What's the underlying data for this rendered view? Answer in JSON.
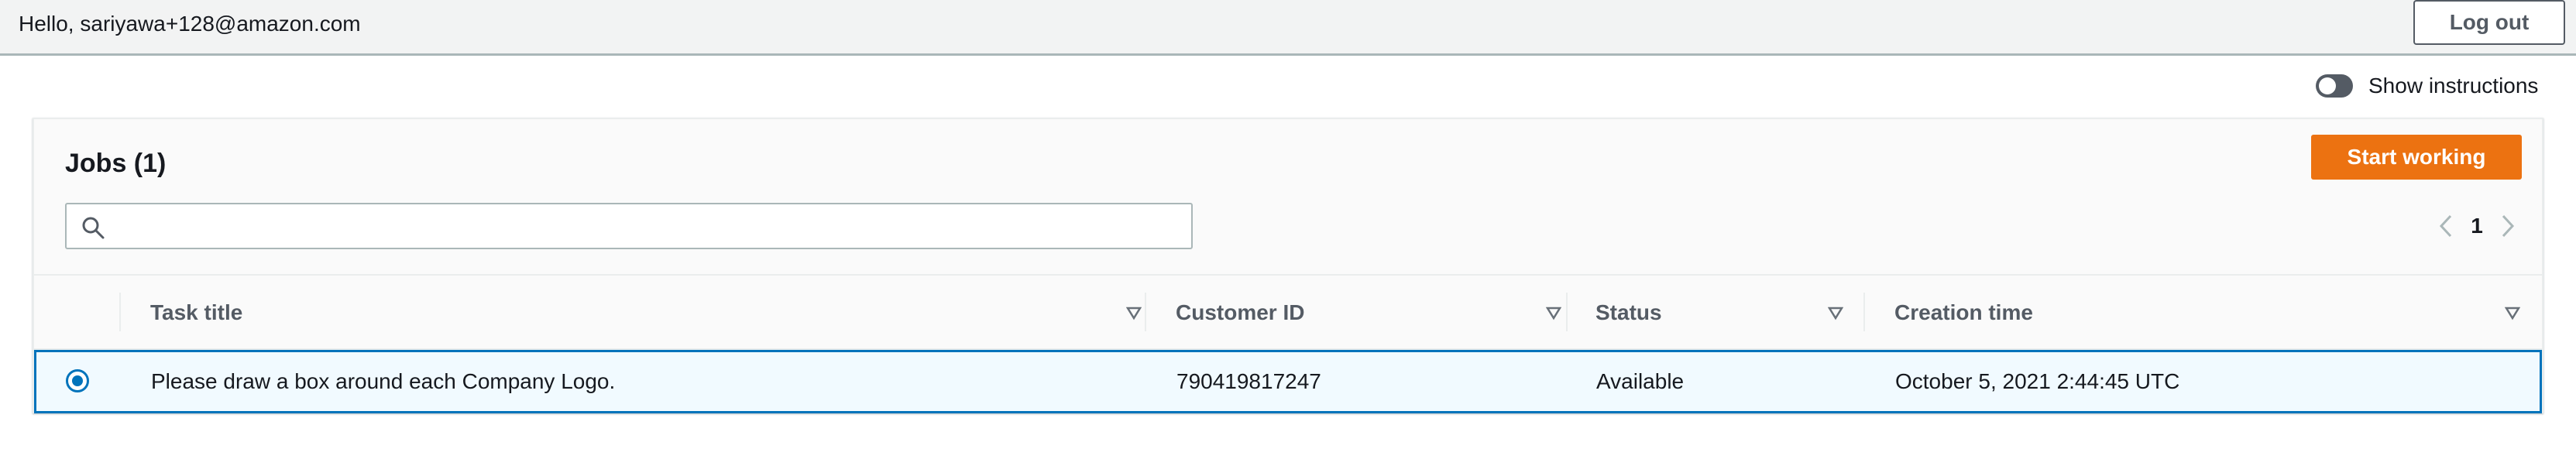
{
  "header": {
    "greeting": "Hello, sariyawa+128@amazon.com",
    "logout_label": "Log out"
  },
  "instructions_toggle": {
    "label": "Show instructions",
    "enabled": false
  },
  "jobs": {
    "title": "Jobs (1)",
    "start_label": "Start working",
    "search": {
      "value": "",
      "placeholder": ""
    },
    "pagination": {
      "current_page": "1"
    },
    "columns": [
      "Task title",
      "Customer ID",
      "Status",
      "Creation time"
    ],
    "rows": [
      {
        "selected": true,
        "task_title": "Please draw a box around each Company Logo.",
        "customer_id": "790419817247",
        "status": "Available",
        "creation_time": "October 5, 2021 2:44:45 UTC"
      }
    ]
  },
  "colors": {
    "accent": "#ec7211",
    "selection": "#0073bb",
    "header_bg": "#f2f3f3"
  }
}
